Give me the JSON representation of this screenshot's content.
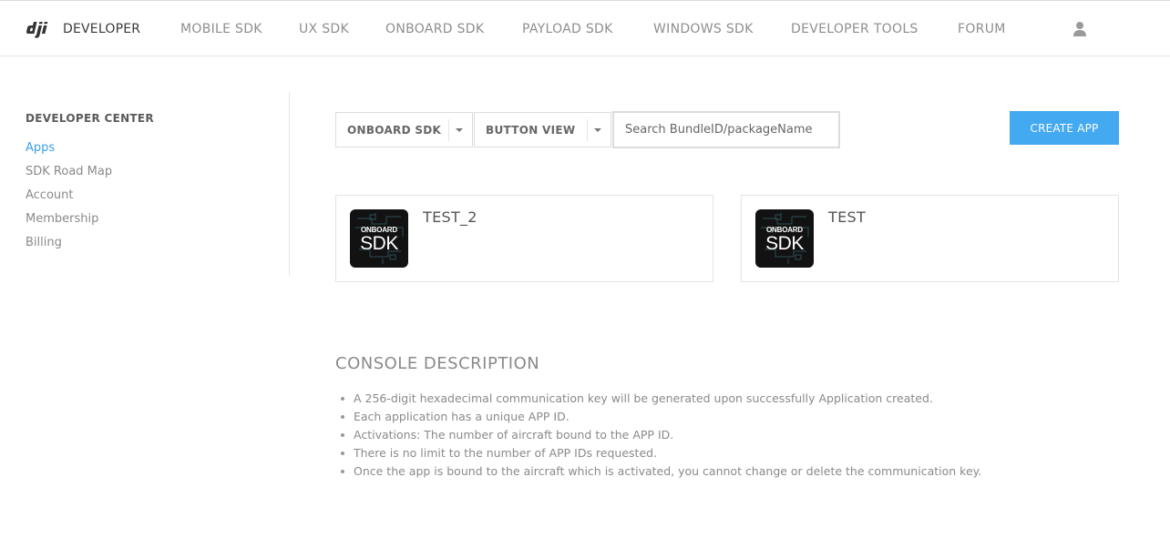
{
  "header": {
    "logo_word": "DEVELOPER",
    "nav": [
      {
        "label": "MOBILE SDK"
      },
      {
        "label": "UX SDK"
      },
      {
        "label": "ONBOARD SDK"
      },
      {
        "label": "PAYLOAD SDK"
      },
      {
        "label": "WINDOWS SDK"
      },
      {
        "label": "DEVELOPER TOOLS"
      },
      {
        "label": "FORUM"
      }
    ]
  },
  "sidebar": {
    "title": "DEVELOPER CENTER",
    "items": [
      {
        "label": "Apps",
        "active": true
      },
      {
        "label": "SDK Road Map"
      },
      {
        "label": "Account"
      },
      {
        "label": "Membership"
      },
      {
        "label": "Billing"
      }
    ]
  },
  "toolbar": {
    "sdk_select": "ONBOARD SDK",
    "view_select": "BUTTON VIEW",
    "search_placeholder": "Search BundleID/packageName",
    "create_label": "CREATE APP"
  },
  "apps": [
    {
      "name": "TEST_2",
      "logo_top": "ONBOARD",
      "logo_bottom": "SDK"
    },
    {
      "name": "TEST",
      "logo_top": "ONBOARD",
      "logo_bottom": "SDK"
    }
  ],
  "description": {
    "title": "CONSOLE DESCRIPTION",
    "items": [
      "A 256-digit hexadecimal communication key will be generated upon successfully Application created.",
      "Each application has a unique APP ID.",
      "Activations: The number of aircraft bound to the APP ID.",
      "There is no limit to the number of APP IDs requested.",
      "Once the app is bound to the aircraft which is activated, you cannot change or delete the communication key."
    ]
  },
  "colors": {
    "accent": "#3aa0e6",
    "button": "#43a9f0",
    "app_logo_bg": "#121212"
  }
}
